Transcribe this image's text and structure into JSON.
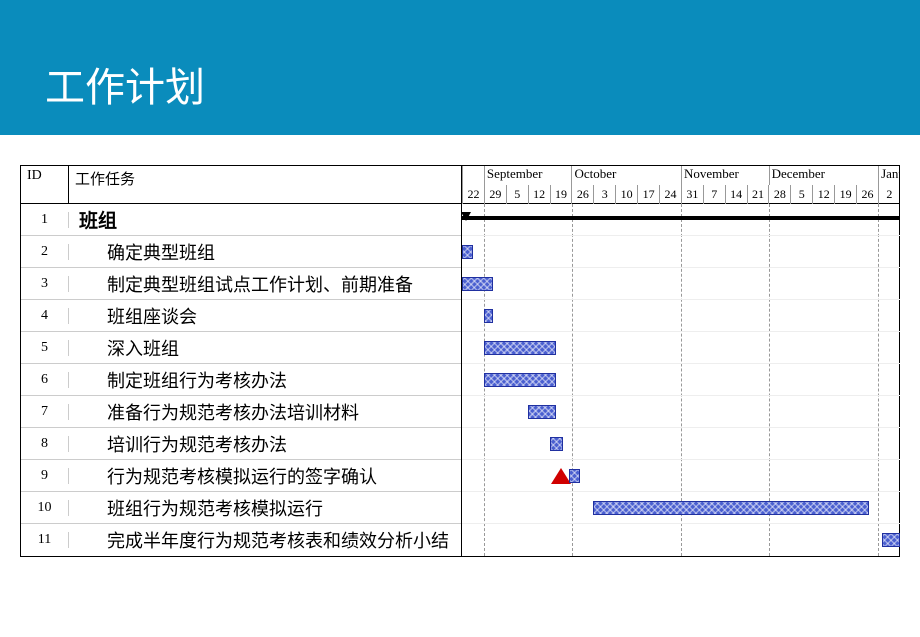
{
  "header": {
    "title": "工作计划"
  },
  "columns": {
    "id": "ID",
    "task": "工作任务"
  },
  "timeline": {
    "months": [
      {
        "label": "",
        "weeks": 1
      },
      {
        "label": "September",
        "weeks": 4
      },
      {
        "label": "October",
        "weeks": 5
      },
      {
        "label": "November",
        "weeks": 4
      },
      {
        "label": "December",
        "weeks": 5
      },
      {
        "label": "Janu",
        "weeks": 1
      }
    ],
    "weeks": [
      "22",
      "29",
      "5",
      "12",
      "19",
      "26",
      "3",
      "10",
      "17",
      "24",
      "31",
      "7",
      "14",
      "21",
      "28",
      "5",
      "12",
      "19",
      "26",
      "2"
    ]
  },
  "tasks": [
    {
      "id": "1",
      "name": "班组",
      "indent": 0,
      "bold": true,
      "type": "summary",
      "start": 0,
      "end": 20
    },
    {
      "id": "2",
      "name": "确定典型班组",
      "indent": 1,
      "bold": false,
      "type": "bar",
      "start": 0,
      "end": 0.5
    },
    {
      "id": "3",
      "name": "制定典型班组试点工作计划、前期准备",
      "indent": 1,
      "bold": false,
      "type": "bar",
      "start": 0,
      "end": 1.4
    },
    {
      "id": "4",
      "name": "班组座谈会",
      "indent": 1,
      "bold": false,
      "type": "bar",
      "start": 1.0,
      "end": 1.4
    },
    {
      "id": "5",
      "name": "深入班组",
      "indent": 1,
      "bold": false,
      "type": "bar",
      "start": 1.0,
      "end": 4.3
    },
    {
      "id": "6",
      "name": "制定班组行为考核办法",
      "indent": 1,
      "bold": false,
      "type": "bar",
      "start": 1.0,
      "end": 4.3
    },
    {
      "id": "7",
      "name": "准备行为规范考核办法培训材料",
      "indent": 1,
      "bold": false,
      "type": "bar",
      "start": 3.0,
      "end": 4.3
    },
    {
      "id": "8",
      "name": "培训行为规范考核办法",
      "indent": 1,
      "bold": false,
      "type": "bar",
      "start": 4.0,
      "end": 4.6
    },
    {
      "id": "9",
      "name": "行为规范考核模拟运行的签字确认",
      "indent": 1,
      "bold": false,
      "type": "milestone",
      "start": 4.5,
      "end": 4.5,
      "extra_bar_end": 5.4
    },
    {
      "id": "10",
      "name": "班组行为规范考核模拟运行",
      "indent": 1,
      "bold": false,
      "type": "bar",
      "start": 6.0,
      "end": 18.6
    },
    {
      "id": "11",
      "name": "完成半年度行为规范考核表和绩效分析小结",
      "indent": 1,
      "bold": false,
      "type": "bar",
      "start": 19.2,
      "end": 20
    }
  ],
  "chart_data": {
    "type": "gantt",
    "title": "工作计划",
    "x_unit": "flex-friendly units — each week ≈ 21.9px",
    "tasks_ref": "see tasks array above (start/end are week-column indices from 22-Aug)"
  }
}
